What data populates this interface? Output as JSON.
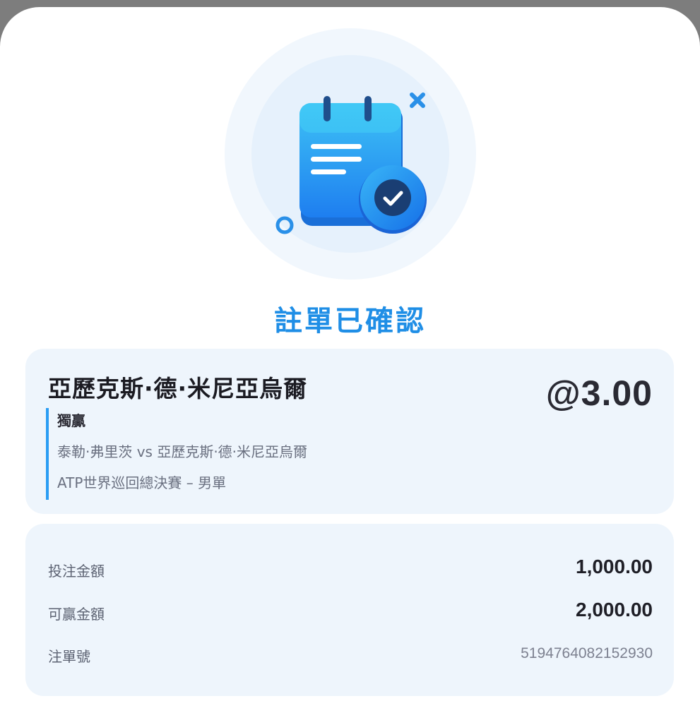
{
  "confirmation": {
    "title": "註單已確認",
    "icon": "calendar-check-icon"
  },
  "bet": {
    "selection": "亞歷克斯·德·米尼亞烏爾",
    "odds": "@3.00",
    "market": "獨贏",
    "event": "泰勒·弗里茨 vs 亞歷克斯·德·米尼亞烏爾",
    "league": "ATP世界巡回總決賽 – 男單"
  },
  "summary": {
    "stake_label": "投注金額",
    "stake_value": "1,000.00",
    "payout_label": "可贏金額",
    "payout_value": "2,000.00",
    "ticket_label": "注單號",
    "ticket_value": "5194764082152930"
  },
  "colors": {
    "accent": "#1f8ee6",
    "card_background": "#eef5fc",
    "detail_bar": "#2a9df4"
  }
}
